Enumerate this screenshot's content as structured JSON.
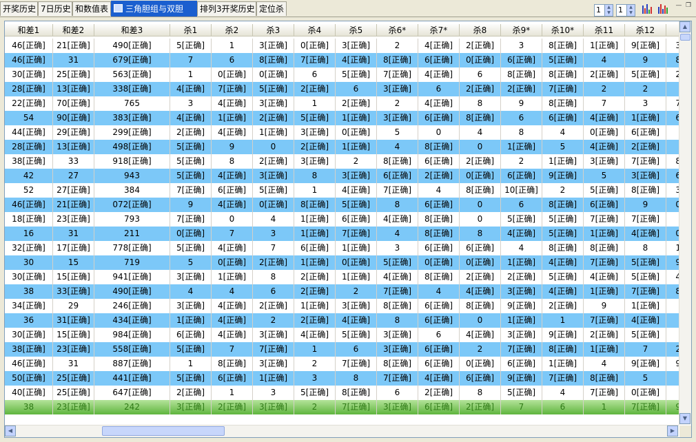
{
  "tabs": [
    {
      "label": "开奖历史",
      "active": false
    },
    {
      "label": "7日历史",
      "active": false
    },
    {
      "label": "和数值表",
      "active": false
    },
    {
      "label": "三角胆组与双胆",
      "active": true
    },
    {
      "label": "排列3开奖历史",
      "active": false
    },
    {
      "label": "定位杀",
      "active": false
    }
  ],
  "spinners": [
    {
      "value": "1"
    },
    {
      "value": "1"
    }
  ],
  "columns": [
    "和差1",
    "和差2",
    "和差3",
    "杀1",
    "杀2",
    "杀3",
    "杀4",
    "杀5",
    "杀6*",
    "杀7*",
    "杀8",
    "杀9*",
    "杀10*",
    "杀11",
    "杀12",
    ""
  ],
  "rows": [
    [
      "46[正确]",
      "21[正确]",
      "490[正确]",
      "5[正确]",
      "1",
      "3[正确]",
      "0[正确]",
      "3[正确]",
      "2",
      "4[正确]",
      "2[正确]",
      "3",
      "8[正确]",
      "1[正确]",
      "9[正确]",
      "3["
    ],
    [
      "46[正确]",
      "31",
      "679[正确]",
      "7",
      "6",
      "8[正确]",
      "7[正确]",
      "4[正确]",
      "8[正确]",
      "6[正确]",
      "0[正确]",
      "6[正确]",
      "5[正确]",
      "4",
      "9",
      "8["
    ],
    [
      "30[正确]",
      "25[正确]",
      "563[正确]",
      "1",
      "0[正确]",
      "0[正确]",
      "6",
      "5[正确]",
      "7[正确]",
      "4[正确]",
      "6",
      "8[正确]",
      "8[正确]",
      "2[正确]",
      "5[正确]",
      "2["
    ],
    [
      "28[正确]",
      "13[正确]",
      "338[正确]",
      "4[正确]",
      "7[正确]",
      "5[正确]",
      "2[正确]",
      "6",
      "3[正确]",
      "6",
      "2[正确]",
      "2[正确]",
      "7[正确]",
      "2",
      "2",
      ""
    ],
    [
      "22[正确]",
      "70[正确]",
      "765",
      "3",
      "4[正确]",
      "3[正确]",
      "1",
      "2[正确]",
      "2",
      "4[正确]",
      "8",
      "9",
      "8[正确]",
      "7",
      "3",
      "7["
    ],
    [
      "54",
      "90[正确]",
      "383[正确]",
      "4[正确]",
      "1[正确]",
      "2[正确]",
      "5[正确]",
      "1[正确]",
      "3[正确]",
      "6[正确]",
      "8[正确]",
      "6",
      "6[正确]",
      "4[正确]",
      "1[正确]",
      "6["
    ],
    [
      "44[正确]",
      "29[正确]",
      "299[正确]",
      "2[正确]",
      "4[正确]",
      "1[正确]",
      "3[正确]",
      "0[正确]",
      "5",
      "0",
      "4",
      "8",
      "4",
      "0[正确]",
      "6[正确]",
      ""
    ],
    [
      "28[正确]",
      "13[正确]",
      "498[正确]",
      "5[正确]",
      "9",
      "0",
      "2[正确]",
      "1[正确]",
      "4",
      "8[正确]",
      "0",
      "1[正确]",
      "5",
      "4[正确]",
      "2[正确]",
      ""
    ],
    [
      "38[正确]",
      "33",
      "918[正确]",
      "5[正确]",
      "8",
      "2[正确]",
      "3[正确]",
      "2",
      "8[正确]",
      "6[正确]",
      "2[正确]",
      "2",
      "1[正确]",
      "3[正确]",
      "7[正确]",
      "8["
    ],
    [
      "42",
      "27",
      "943",
      "5[正确]",
      "4[正确]",
      "3[正确]",
      "8",
      "3[正确]",
      "6[正确]",
      "2[正确]",
      "0[正确]",
      "6[正确]",
      "9[正确]",
      "5",
      "3[正确]",
      "6["
    ],
    [
      "52",
      "27[正确]",
      "384",
      "7[正确]",
      "6[正确]",
      "5[正确]",
      "1",
      "4[正确]",
      "7[正确]",
      "4",
      "8[正确]",
      "10[正确]",
      "2",
      "5[正确]",
      "8[正确]",
      "3["
    ],
    [
      "46[正确]",
      "21[正确]",
      "072[正确]",
      "9",
      "4[正确]",
      "0[正确]",
      "8[正确]",
      "5[正确]",
      "8",
      "6[正确]",
      "0",
      "6",
      "8[正确]",
      "6[正确]",
      "9",
      "0["
    ],
    [
      "18[正确]",
      "23[正确]",
      "793",
      "7[正确]",
      "0",
      "4",
      "1[正确]",
      "6[正确]",
      "4[正确]",
      "8[正确]",
      "0",
      "5[正确]",
      "5[正确]",
      "7[正确]",
      "7[正确]",
      ""
    ],
    [
      "16",
      "31",
      "211",
      "0[正确]",
      "7",
      "3",
      "1[正确]",
      "7[正确]",
      "4",
      "8[正确]",
      "8",
      "4[正确]",
      "5[正确]",
      "1[正确]",
      "4[正确]",
      "0["
    ],
    [
      "32[正确]",
      "17[正确]",
      "778[正确]",
      "5[正确]",
      "4[正确]",
      "7",
      "6[正确]",
      "1[正确]",
      "3",
      "6[正确]",
      "6[正确]",
      "4",
      "8[正确]",
      "8[正确]",
      "8",
      "1["
    ],
    [
      "30",
      "15",
      "719",
      "5",
      "0[正确]",
      "2[正确]",
      "1[正确]",
      "0[正确]",
      "5[正确]",
      "0[正确]",
      "0[正确]",
      "1[正确]",
      "4[正确]",
      "7[正确]",
      "5[正确]",
      "9["
    ],
    [
      "30[正确]",
      "15[正确]",
      "941[正确]",
      "3[正确]",
      "1[正确]",
      "8",
      "2[正确]",
      "1[正确]",
      "4[正确]",
      "8[正确]",
      "2[正确]",
      "2[正确]",
      "5[正确]",
      "4[正确]",
      "5[正确]",
      "4["
    ],
    [
      "38",
      "33[正确]",
      "490[正确]",
      "4",
      "4",
      "6",
      "2[正确]",
      "2",
      "7[正确]",
      "4",
      "4[正确]",
      "3[正确]",
      "4[正确]",
      "1[正确]",
      "7[正确]",
      "8["
    ],
    [
      "34[正确]",
      "29",
      "246[正确]",
      "3[正确]",
      "4[正确]",
      "2[正确]",
      "1[正确]",
      "3[正确]",
      "8[正确]",
      "6[正确]",
      "8[正确]",
      "9[正确]",
      "2[正确]",
      "9",
      "1[正确]",
      ""
    ],
    [
      "36",
      "31[正确]",
      "434[正确]",
      "1[正确]",
      "4[正确]",
      "2",
      "2[正确]",
      "4[正确]",
      "8",
      "6[正确]",
      "0",
      "1[正确]",
      "1",
      "7[正确]",
      "4[正确]",
      ""
    ],
    [
      "30[正确]",
      "15[正确]",
      "984[正确]",
      "6[正确]",
      "4[正确]",
      "3[正确]",
      "4[正确]",
      "5[正确]",
      "3[正确]",
      "6",
      "4[正确]",
      "3[正确]",
      "9[正确]",
      "2[正确]",
      "5[正确]",
      ""
    ],
    [
      "38[正确]",
      "23[正确]",
      "558[正确]",
      "5[正确]",
      "7",
      "7[正确]",
      "1",
      "6",
      "3[正确]",
      "6[正确]",
      "2",
      "7[正确]",
      "8[正确]",
      "1[正确]",
      "7",
      "2["
    ],
    [
      "46[正确]",
      "31",
      "887[正确]",
      "1",
      "8[正确]",
      "3[正确]",
      "2",
      "7[正确]",
      "8[正确]",
      "6[正确]",
      "0[正确]",
      "6[正确]",
      "1[正确]",
      "4",
      "9[正确]",
      "9["
    ],
    [
      "50[正确]",
      "25[正确]",
      "441[正确]",
      "5[正确]",
      "6[正确]",
      "1[正确]",
      "3",
      "8",
      "7[正确]",
      "4[正确]",
      "6[正确]",
      "9[正确]",
      "7[正确]",
      "8[正确]",
      "5",
      ""
    ],
    [
      "40[正确]",
      "25[正确]",
      "647[正确]",
      "2[正确]",
      "1",
      "3",
      "5[正确]",
      "8[正确]",
      "6",
      "2[正确]",
      "8",
      "5[正确]",
      "4",
      "7[正确]",
      "0[正确]",
      ""
    ],
    [
      "38",
      "23[正确]",
      "242",
      "3[正确]",
      "2[正确]",
      "3[正确]",
      "2",
      "7[正确]",
      "3[正确]",
      "6[正确]",
      "2[正确]",
      "7",
      "6",
      "1",
      "7[正确]",
      "9["
    ]
  ]
}
